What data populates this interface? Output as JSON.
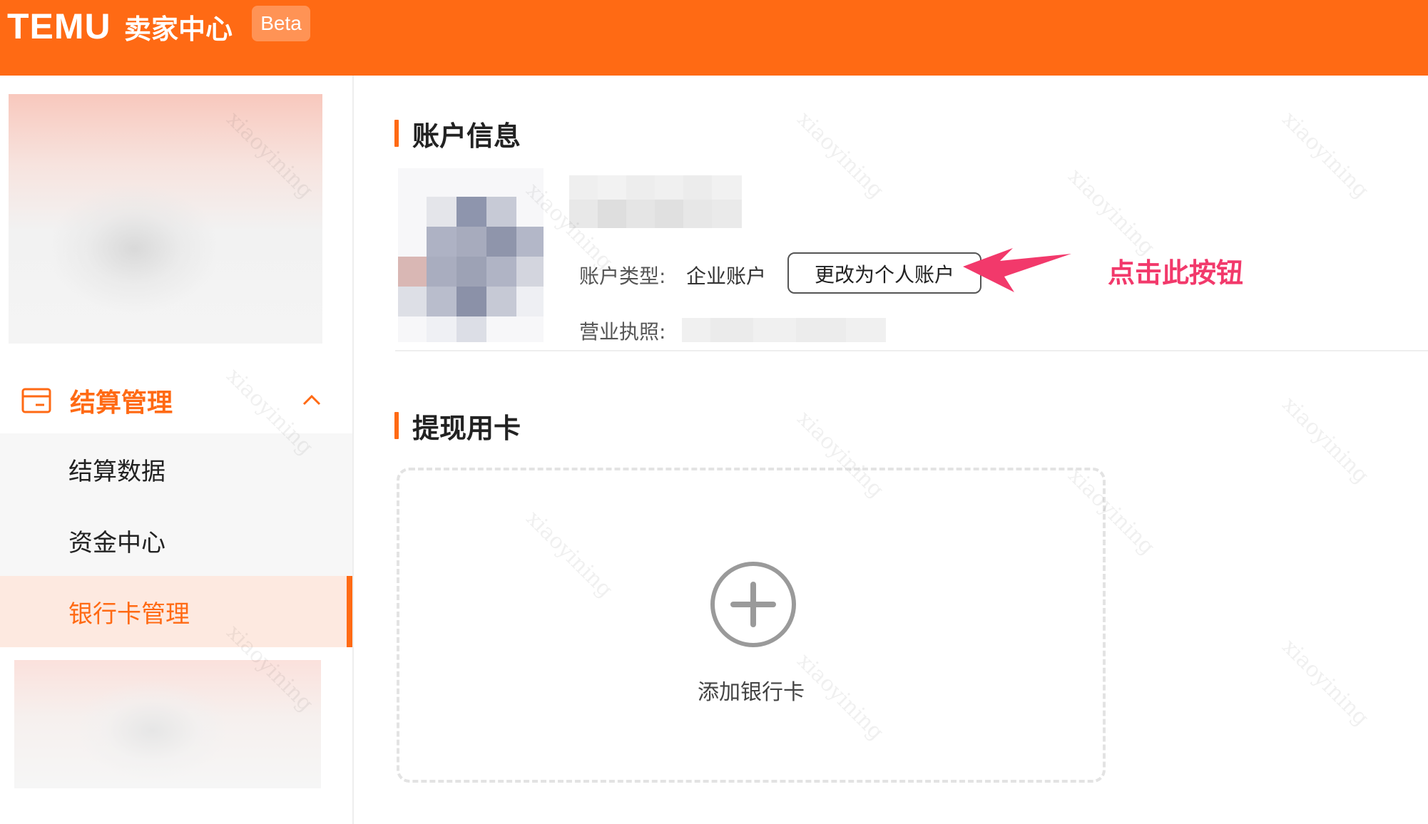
{
  "header": {
    "logo": "TEMU",
    "app_name": "卖家中心",
    "badge": "Beta"
  },
  "sidebar": {
    "group": {
      "label": "结算管理",
      "icon": "card-icon",
      "expanded": true
    },
    "items": [
      {
        "label": "结算数据",
        "active": false
      },
      {
        "label": "资金中心",
        "active": false
      },
      {
        "label": "银行卡管理",
        "active": true
      }
    ]
  },
  "account_info": {
    "title": "账户信息",
    "account_type_label": "账户类型:",
    "account_type_value": "企业账户",
    "change_button": "更改为个人账户",
    "license_label": "营业执照:"
  },
  "annotation": {
    "hint": "点击此按钮",
    "color": "#f2396b"
  },
  "withdraw_card": {
    "title": "提现用卡",
    "add_label": "添加银行卡"
  },
  "watermark": "xiaoyining",
  "colors": {
    "brand": "#ff6a14",
    "active_bg": "#fde9e0"
  }
}
